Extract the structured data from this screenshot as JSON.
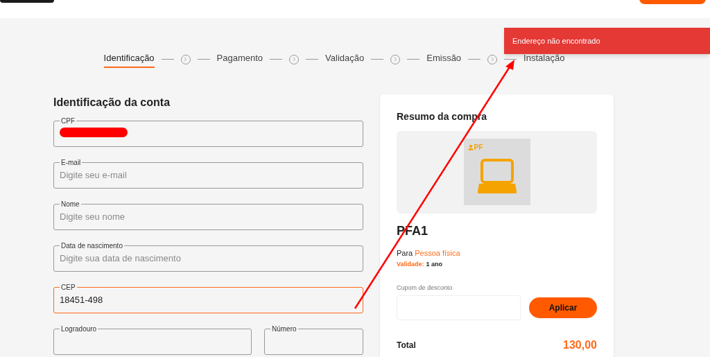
{
  "steps": [
    {
      "label": "Identificação",
      "selected": true
    },
    {
      "label": "Pagamento",
      "selected": false
    },
    {
      "label": "Validação",
      "selected": false
    },
    {
      "label": "Emissão",
      "selected": false
    },
    {
      "label": "Instalação",
      "selected": false
    }
  ],
  "toast": {
    "message": "Endereço não encontrado"
  },
  "form": {
    "title": "Identificação da conta",
    "fields": [
      {
        "label": "CPF",
        "kind": "redacted",
        "focused": false
      },
      {
        "label": "E-mail",
        "kind": "text",
        "placeholder": "Digite seu e-mail",
        "focused": false
      },
      {
        "label": "Nome",
        "kind": "text",
        "placeholder": "Digite seu nome",
        "focused": false
      },
      {
        "label": "Data de nascimento",
        "kind": "text",
        "placeholder": "Digite sua data de nascimento",
        "focused": false
      },
      {
        "label": "CEP",
        "kind": "text",
        "value": "18451-498",
        "focused": true
      }
    ],
    "split_fields": [
      {
        "label": "Logradouro",
        "focused": false
      },
      {
        "label": "Número",
        "focused": false
      }
    ]
  },
  "summary": {
    "title": "Resumo da compra",
    "badge": "PF",
    "product": "PFA1",
    "for_label": "Para",
    "for_value": "Pessoa física",
    "validity_label": "Validade:",
    "validity_value": "1 ano",
    "coupon_label": "Cupom de desconto",
    "apply_button": "Aplicar",
    "total_label": "Total",
    "total_value": "130,00"
  }
}
